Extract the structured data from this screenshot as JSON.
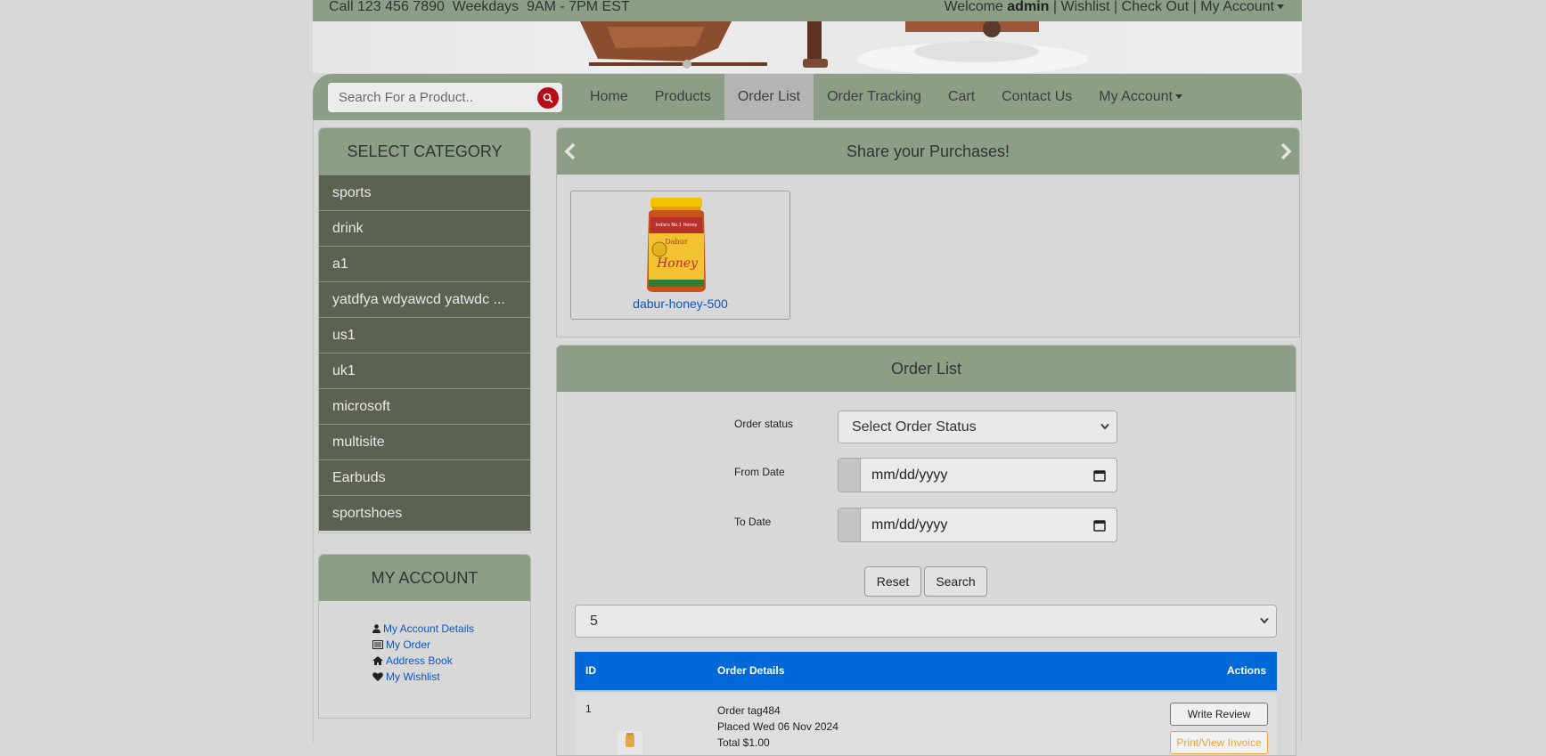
{
  "topbar": {
    "contact": "Call 123 456 7890  Weekdays  9AM - 7PM EST",
    "welcome": "Welcome",
    "user": "admin",
    "sep": "|",
    "wishlist": "Wishlist",
    "checkout": "Check Out",
    "my_account": "My Account"
  },
  "search": {
    "placeholder": "Search For a Product.."
  },
  "nav": {
    "items": [
      {
        "label": "Home"
      },
      {
        "label": "Products"
      },
      {
        "label": "Order List",
        "active": true
      },
      {
        "label": "Order Tracking"
      },
      {
        "label": "Cart"
      },
      {
        "label": "Contact Us"
      },
      {
        "label": "My Account"
      }
    ]
  },
  "category": {
    "title": "SELECT CATEGORY",
    "items": [
      "sports",
      "drink",
      "a1",
      "yatdfya wdyawcd yatwdc ...",
      "us1",
      "uk1",
      "microsoft",
      "multisite",
      "Earbuds",
      "sportshoes"
    ]
  },
  "account": {
    "title": "MY ACCOUNT",
    "links": [
      "My Account Details",
      "My Order",
      "Address Book",
      "My Wishlist"
    ]
  },
  "share": {
    "title": "Share your Purchases!",
    "product_name": "dabur-honey-500",
    "product_label_top": "India's No.1 Honey",
    "product_label_brand": "Dabur",
    "product_label_main": "Honey"
  },
  "order_list": {
    "title": "Order List",
    "status_label": "Order status",
    "status_value": "Select Order Status",
    "from_label": "From Date",
    "from_value": "mm/dd/yyyy",
    "to_label": "To Date",
    "to_value": "mm/dd/yyyy",
    "reset": "Reset",
    "search": "Search",
    "page_size": "5",
    "columns": {
      "id": "ID",
      "details": "Order Details",
      "actions": "Actions"
    },
    "rows": [
      {
        "id": "1",
        "order": "Order tag484",
        "placed": "Placed Wed 06 Nov 2024",
        "total": "Total $1.00",
        "review": "Write Review",
        "invoice": "Print/View Invoice"
      }
    ]
  },
  "colors": {
    "header_green": "#8c9e85",
    "category_item": "#5c6252",
    "table_head": "#0069d9",
    "link_blue": "#0d55c9",
    "search_red": "#b80d18"
  }
}
